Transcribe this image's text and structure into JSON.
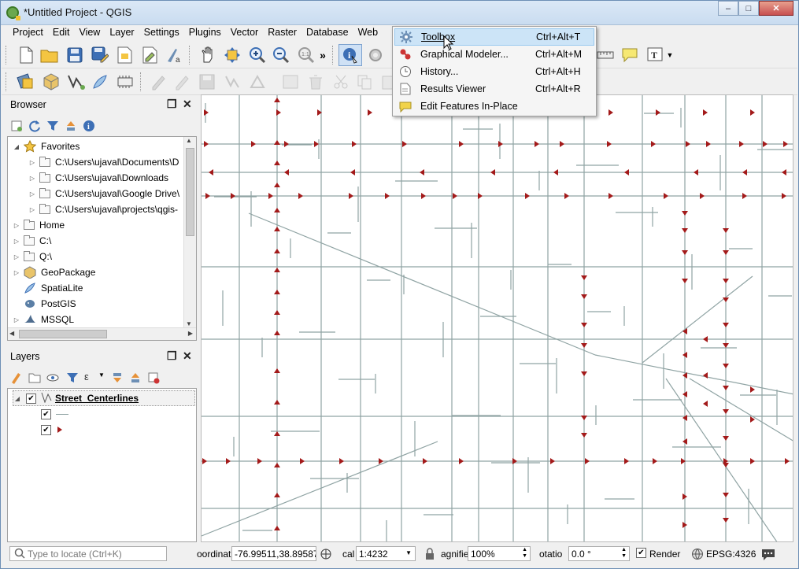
{
  "window": {
    "title": "*Untitled Project - QGIS",
    "controls": {
      "minimize": "–",
      "maximize": "□",
      "close": "✕"
    }
  },
  "menu": [
    "Project",
    "Edit",
    "View",
    "Layer",
    "Settings",
    "Plugins",
    "Vector",
    "Raster",
    "Database",
    "Web"
  ],
  "processing_menu": {
    "items": [
      {
        "label": "Toolbox",
        "shortcut": "Ctrl+Alt+T",
        "icon": "gear-icon",
        "highlighted": true
      },
      {
        "label": "Graphical Modeler...",
        "shortcut": "Ctrl+Alt+M",
        "icon": "modeler-icon"
      },
      {
        "label": "History...",
        "shortcut": "Ctrl+Alt+H",
        "icon": "history-icon"
      },
      {
        "label": "Results Viewer",
        "shortcut": "Ctrl+Alt+R",
        "icon": "results-icon"
      },
      {
        "label": "Edit Features In-Place",
        "shortcut": "",
        "icon": "edit-in-place-icon"
      }
    ]
  },
  "toolbar_overflow": "»",
  "browser": {
    "title": "Browser",
    "items": [
      {
        "label": "Favorites",
        "icon": "star-icon",
        "level": 0,
        "expanded": true
      },
      {
        "label": "C:\\Users\\ujaval\\Documents\\D",
        "icon": "folder-icon",
        "level": 1
      },
      {
        "label": "C:\\Users\\ujaval\\Downloads",
        "icon": "folder-icon",
        "level": 1
      },
      {
        "label": "C:\\Users\\ujaval\\Google Drive\\",
        "icon": "folder-icon",
        "level": 1
      },
      {
        "label": "C:\\Users\\ujaval\\projects\\qgis-",
        "icon": "folder-icon",
        "level": 1
      },
      {
        "label": "Home",
        "icon": "folder-icon",
        "level": 0
      },
      {
        "label": "C:\\",
        "icon": "folder-icon",
        "level": 0
      },
      {
        "label": "Q:\\",
        "icon": "folder-icon",
        "level": 0
      },
      {
        "label": "GeoPackage",
        "icon": "geopackage-icon",
        "level": 0
      },
      {
        "label": "SpatiaLite",
        "icon": "spatialite-icon",
        "level": 0
      },
      {
        "label": "PostGIS",
        "icon": "postgis-icon",
        "level": 0
      },
      {
        "label": "MSSQL",
        "icon": "mssql-icon",
        "level": 0
      }
    ]
  },
  "layers": {
    "title": "Layers",
    "layer_name": "Street_Centerlines"
  },
  "status": {
    "search_placeholder": "Type to locate (Ctrl+K)",
    "coordinate_label": "oordinat",
    "coordinate_value": "-76.99511,38.89587",
    "scale_label": "cal",
    "scale_value": "1:4232",
    "magnifier_label": "agnifie",
    "magnifier_value": "100%",
    "rotation_label": "otatio",
    "rotation_value": "0.0 °",
    "render_label": "Render",
    "crs": "EPSG:4326"
  },
  "colors": {
    "accent": "#cce4f7",
    "arrow": "#a31a1a",
    "road": "#8fa3a3"
  }
}
